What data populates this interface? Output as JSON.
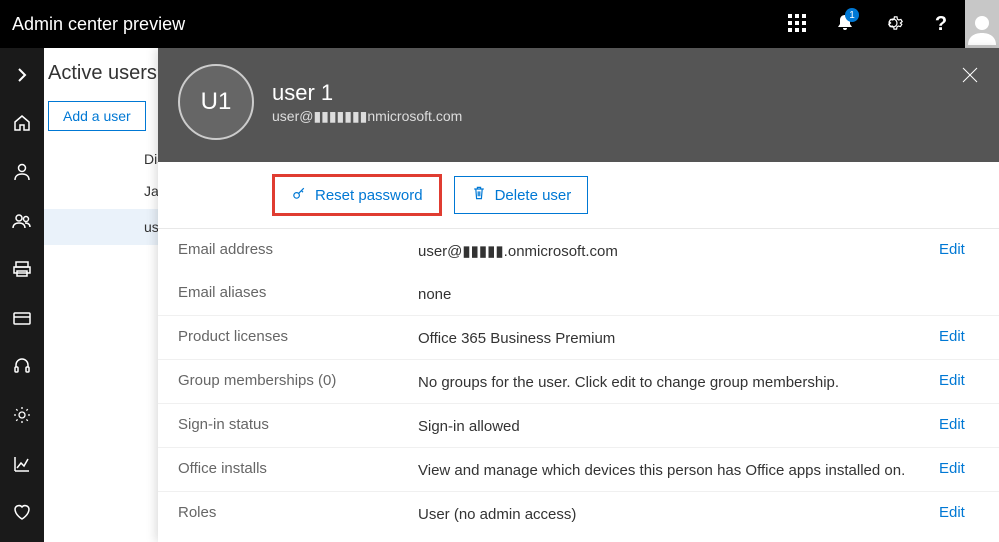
{
  "header": {
    "title": "Admin center preview",
    "notif_count": "1"
  },
  "page": {
    "title": "Active users",
    "add_user": "Add a user",
    "col_display": "Disp",
    "rows": [
      "Jag",
      "use"
    ]
  },
  "flyout": {
    "initials": "U1",
    "name": "user 1",
    "email": "user@▮▮▮▮▮▮▮nmicrosoft.com",
    "reset_pw": "Reset password",
    "delete_user": "Delete user",
    "edit_label": "Edit",
    "details": [
      {
        "label": "Email address",
        "value": "user@▮▮▮▮▮.onmicrosoft.com",
        "edit": true
      },
      {
        "label": "Email aliases",
        "value": "none",
        "edit": false
      },
      {
        "label": "Product licenses",
        "value": "Office 365 Business Premium",
        "edit": true
      },
      {
        "label": "Group memberships (0)",
        "value": "No groups for the user. Click edit to change group membership.",
        "edit": true
      },
      {
        "label": "Sign-in status",
        "value": "Sign-in allowed",
        "edit": true
      },
      {
        "label": "Office installs",
        "value": "View and manage which devices this person has Office apps installed on.",
        "edit": true
      },
      {
        "label": "Roles",
        "value": "User (no admin access)",
        "edit": true
      }
    ]
  }
}
